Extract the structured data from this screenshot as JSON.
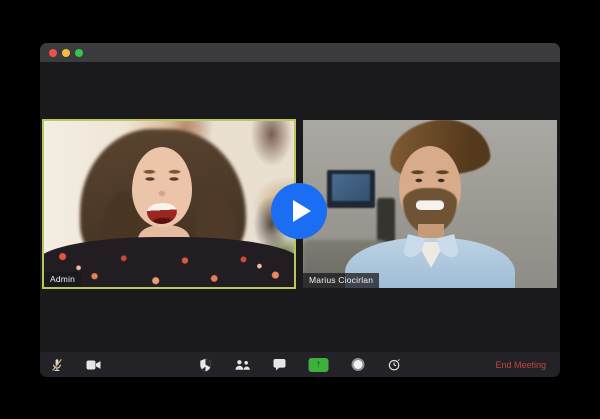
{
  "window": {
    "traffic_lights": [
      {
        "name": "close",
        "color": "#f0514a"
      },
      {
        "name": "minimize",
        "color": "#f5bd3f"
      },
      {
        "name": "zoom",
        "color": "#33c748"
      }
    ]
  },
  "participants": [
    {
      "name": "Admin",
      "active_speaker": true
    },
    {
      "name": "Marius Ciocirlan",
      "active_speaker": false
    }
  ],
  "overlay": {
    "play_icon": "play-icon"
  },
  "toolbar": {
    "left_buttons": [
      {
        "id": "mute",
        "icon": "mic-muted-icon",
        "muted": true
      },
      {
        "id": "video",
        "icon": "video-camera-icon"
      }
    ],
    "center_buttons": [
      {
        "id": "security",
        "icon": "shield-icon"
      },
      {
        "id": "participants",
        "icon": "participants-icon"
      },
      {
        "id": "chat",
        "icon": "chat-bubble-icon"
      },
      {
        "id": "share-screen",
        "icon": "share-screen-icon",
        "arrow_glyph": "↑"
      },
      {
        "id": "record",
        "icon": "record-icon"
      },
      {
        "id": "reactions",
        "icon": "clock-icon"
      }
    ],
    "end_meeting_label": "End Meeting"
  },
  "colors": {
    "play_button_blue": "#1b6ef3",
    "share_screen_green": "#3cb23c",
    "end_meeting_red": "#c04638",
    "active_speaker_border": "#b9c85c",
    "titlebar": "#3b3b3d",
    "window_body": "#1a1a1c",
    "toolbar_bg": "#232327"
  }
}
